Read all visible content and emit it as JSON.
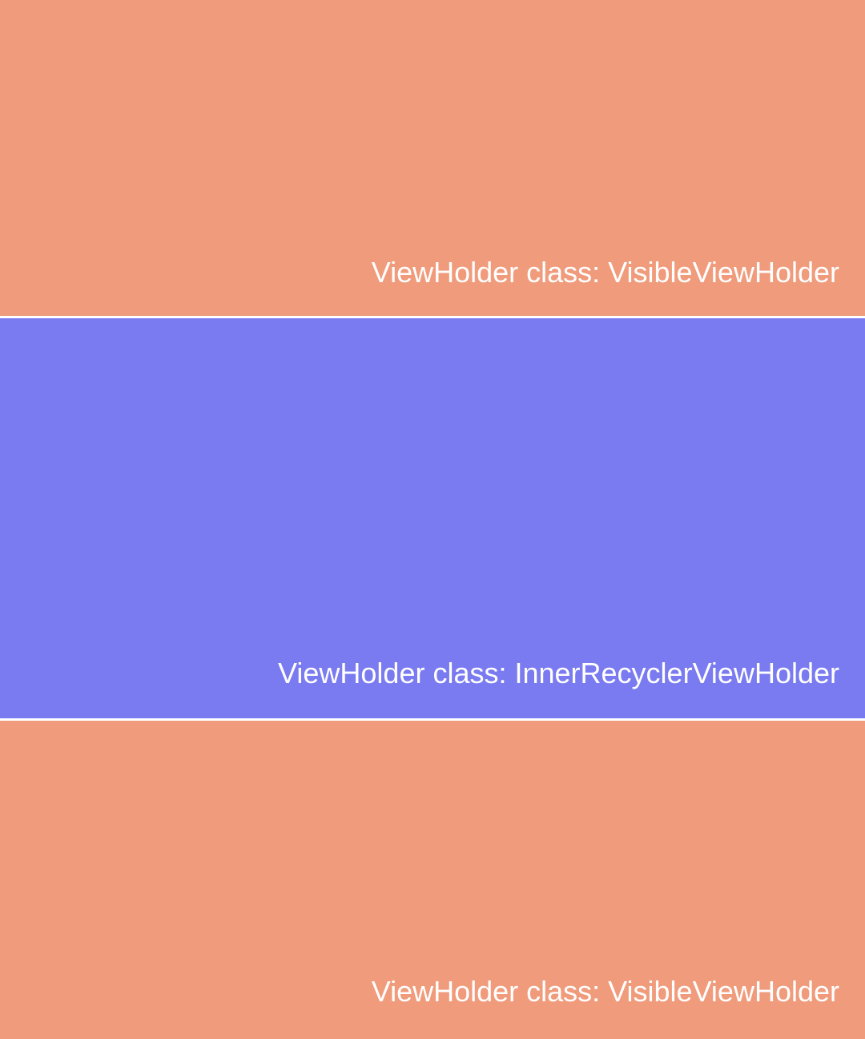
{
  "list": {
    "items": [
      {
        "label": "ViewHolder class: VisibleViewHolder",
        "color": "#F09B7B"
      },
      {
        "label": "ViewHolder class: InnerRecyclerViewHolder",
        "color": "#7A7BF0"
      },
      {
        "label": "ViewHolder class: VisibleViewHolder",
        "color": "#F09B7B"
      }
    ],
    "divider_color": "#FFFFFF"
  }
}
